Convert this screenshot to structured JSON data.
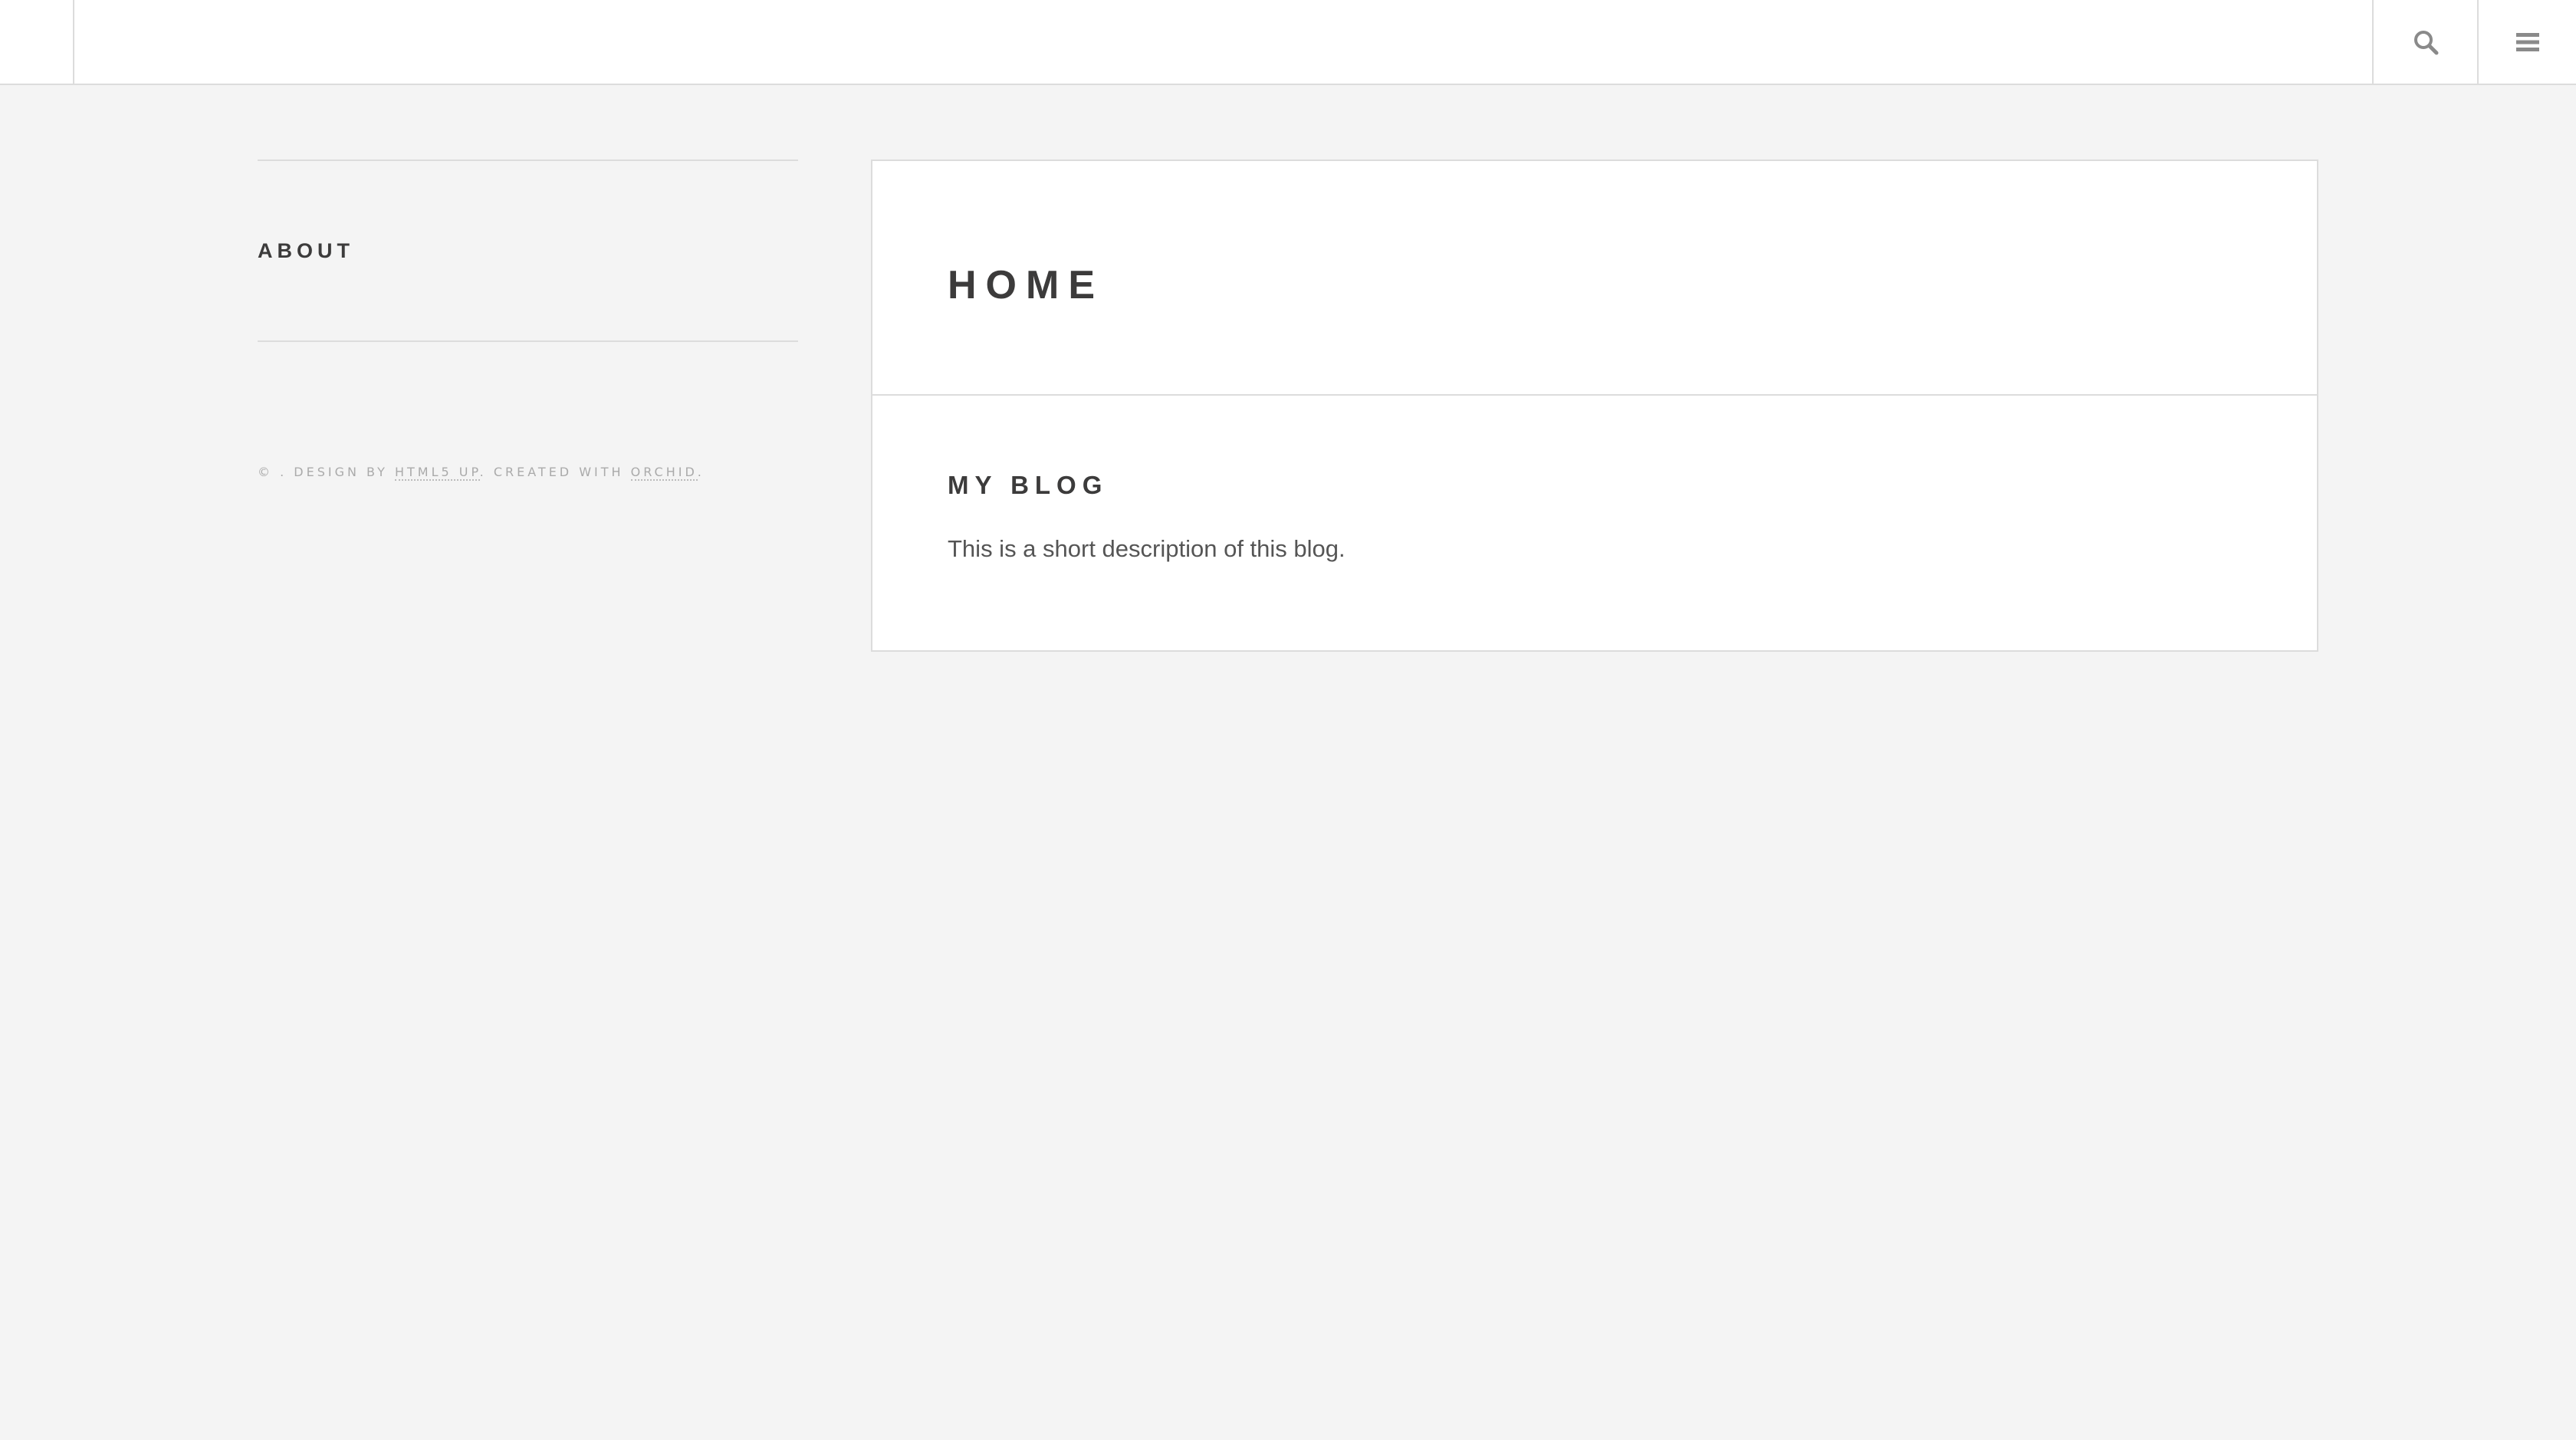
{
  "header": {
    "search_icon": "search-icon",
    "menu_icon": "hamburger-menu-icon"
  },
  "sidebar": {
    "about_label": "ABOUT",
    "copyright": {
      "prefix": "© . DESIGN BY ",
      "design_link": "HTML5 UP",
      "middle": ". CREATED WITH ",
      "created_link": "ORCHID",
      "suffix": "."
    }
  },
  "main": {
    "page_title": "HOME",
    "blog_title": "MY BLOG",
    "blog_description": "This is a short description of this blog."
  },
  "colors": {
    "background": "#f4f4f4",
    "surface": "#ffffff",
    "border": "#dcdcdc",
    "text": "#3c3b3b",
    "muted": "#aaaaaa"
  }
}
